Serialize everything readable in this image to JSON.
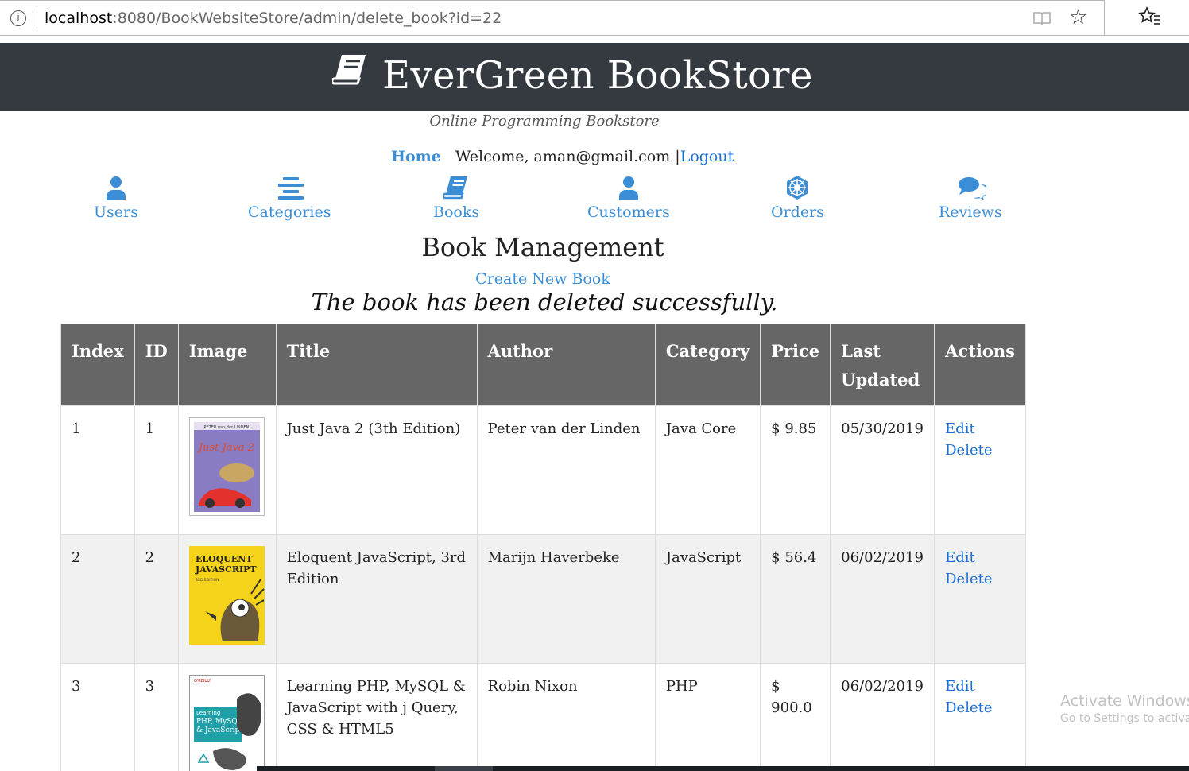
{
  "browser": {
    "url_host": "localhost",
    "url_rest": ":8080/BookWebsiteStore/admin/delete_book?id=22",
    "icons": [
      "info-icon",
      "reading-view-icon",
      "favorite-star-icon",
      "favorites-list-icon"
    ]
  },
  "header": {
    "title": "EverGreen BookStore",
    "tagline": "Online Programming Bookstore",
    "logo_icon": "book-icon"
  },
  "topnav": {
    "home": "Home",
    "welcome": "Welcome, aman@gmail.com |",
    "logout": "Logout"
  },
  "menu": [
    {
      "label": "Users",
      "icon": "user-icon"
    },
    {
      "label": "Categories",
      "icon": "list-icon"
    },
    {
      "label": "Books",
      "icon": "book-icon"
    },
    {
      "label": "Customers",
      "icon": "user-icon"
    },
    {
      "label": "Orders",
      "icon": "orders-icon"
    },
    {
      "label": "Reviews",
      "icon": "comments-icon"
    }
  ],
  "main": {
    "title": "Book Management",
    "create_link": "Create New Book",
    "message": "The book has been deleted successfully."
  },
  "table": {
    "headers": [
      "Index",
      "ID",
      "Image",
      "Title",
      "Author",
      "Category",
      "Price",
      "Last Updated",
      "Actions"
    ],
    "rows": [
      {
        "index": "1",
        "id": "1",
        "title": "Just Java 2 (3th Edition)",
        "author": "Peter van der Linden",
        "category": "Java Core",
        "price": "$ 9.85",
        "updated": "05/30/2019",
        "edit": "Edit",
        "delete": "Delete",
        "cover_text": "Just Java 2",
        "cover_author": "PETER van der LINDEN",
        "cover_color": "#7a6fb8"
      },
      {
        "index": "2",
        "id": "2",
        "title": "Eloquent JavaScript, 3rd Edition",
        "author": "Marijn Haverbeke",
        "category": "JavaScript",
        "price": "$ 56.4",
        "updated": "06/02/2019",
        "edit": "Edit",
        "delete": "Delete",
        "cover_text": "ELOQUENT JAVASCRIPT",
        "cover_author": "3RD EDITION",
        "cover_color": "#f5d31a"
      },
      {
        "index": "3",
        "id": "3",
        "title": "Learning PHP, MySQL & JavaScript with j Query, CSS & HTML5",
        "author": "Robin Nixon",
        "category": "PHP",
        "price": "$ 900.0",
        "updated": "06/02/2019",
        "edit": "Edit",
        "delete": "Delete",
        "cover_text": "Learning PHP, MySQL & JavaScript",
        "cover_author": "O'REILLY",
        "cover_color": "#1fa0a8"
      }
    ]
  },
  "watermark": {
    "title": "Activate Windows",
    "sub": "Go to Settings to activate"
  },
  "colors": {
    "header_bg": "#353a40",
    "link": "#3b8ed6",
    "table_header_bg": "#666666",
    "row_alt_bg": "#f1f1f1"
  }
}
